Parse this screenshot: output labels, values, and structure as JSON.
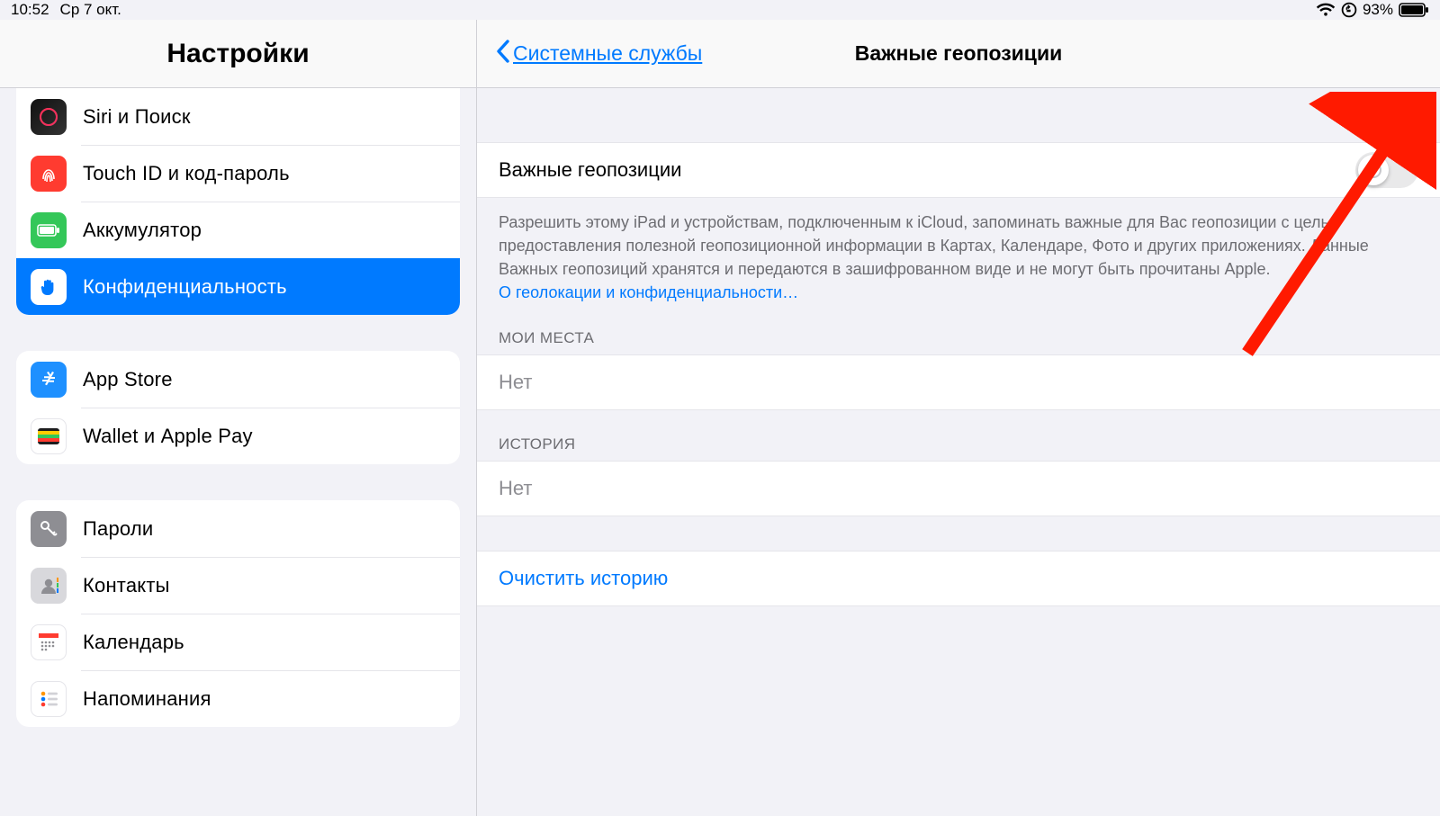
{
  "status": {
    "time": "10:52",
    "date": "Ср 7 окт.",
    "battery_pct": "93%"
  },
  "sidebar": {
    "title": "Настройки",
    "groups": [
      {
        "rows": [
          {
            "key": "siri",
            "label": "Siri и Поиск"
          },
          {
            "key": "touchid",
            "label": "Touch ID и код‑пароль"
          },
          {
            "key": "battery",
            "label": "Аккумулятор"
          },
          {
            "key": "privacy",
            "label": "Конфиденциальность",
            "selected": true
          }
        ]
      },
      {
        "rows": [
          {
            "key": "appstore",
            "label": "App Store"
          },
          {
            "key": "wallet",
            "label": "Wallet и Apple Pay"
          }
        ]
      },
      {
        "rows": [
          {
            "key": "passwords",
            "label": "Пароли"
          },
          {
            "key": "contacts",
            "label": "Контакты"
          },
          {
            "key": "calendar",
            "label": "Календарь"
          },
          {
            "key": "reminders",
            "label": "Напоминания"
          }
        ]
      }
    ]
  },
  "detail": {
    "back_label": "Системные службы",
    "title": "Важные геопозиции",
    "toggle": {
      "label": "Важные геопозиции",
      "on": false
    },
    "footnote": "Разрешить этому iPad и устройствам, подключенным к iCloud, запоминать важные для Вас геопозиции с целью предоставления полезной геопозиционной информации в Картах, Календаре, Фото и других приложениях. Данные Важных геопозиций хранятся и передаются в зашифрованном виде и не могут быть прочитаны Apple.",
    "privacy_link": "О геолокации и конфиденциальности…",
    "sections": {
      "my_places": {
        "header": "МОИ МЕСТА",
        "value": "Нет"
      },
      "history": {
        "header": "ИСТОРИЯ",
        "value": "Нет"
      }
    },
    "clear_history": "Очистить историю"
  }
}
